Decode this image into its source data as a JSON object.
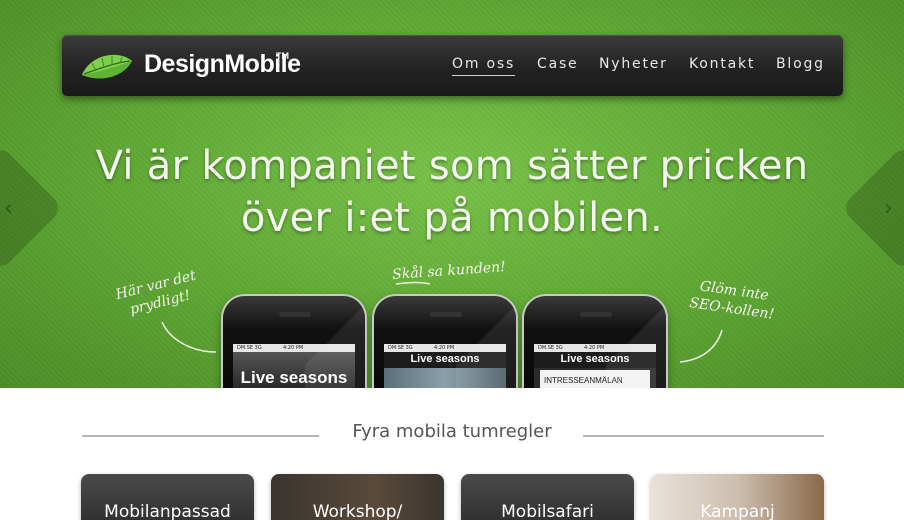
{
  "brand": {
    "name": "DesignMobile",
    "trademark": "TM"
  },
  "nav": {
    "items": [
      {
        "label": "Om oss",
        "active": true
      },
      {
        "label": "Case",
        "active": false
      },
      {
        "label": "Nyheter",
        "active": false
      },
      {
        "label": "Kontakt",
        "active": false
      },
      {
        "label": "Blogg",
        "active": false
      }
    ]
  },
  "hero": {
    "headline_line1": "Vi är kompaniet som sätter pricken",
    "headline_line2": "över i:et på mobilen.",
    "prev_arrow": "‹",
    "next_arrow": "›",
    "notes": {
      "left": "Här var det prydligt!",
      "center": "Skål sa kunden!",
      "right": "Glöm inte SEO-kollen!"
    },
    "phones": [
      {
        "carrier": "DM.SE 3G",
        "time": "4:20 PM",
        "title": "Live seasons"
      },
      {
        "carrier": "DM.SE 3G",
        "time": "4:20 PM",
        "title": "Live seasons"
      },
      {
        "carrier": "DM.SE 3G",
        "time": "4:20 PM",
        "title": "Live seasons",
        "subtitle": "INTRESSEANMÄLAN"
      }
    ]
  },
  "section": {
    "title": "Fyra mobila tumregler"
  },
  "cards": [
    {
      "label": "Mobilanpassad"
    },
    {
      "label": "Workshop/"
    },
    {
      "label": "Mobilsafari"
    },
    {
      "label": "Kampanj"
    }
  ],
  "colors": {
    "hero_green": "#62ac36",
    "navbar": "#222222",
    "leaf_green": "#5fb233",
    "text_light": "#f4f8ee",
    "section_text": "#555555"
  },
  "icons": {
    "logo": "leaf-icon",
    "prev": "chevron-left-icon",
    "next": "chevron-right-icon"
  }
}
